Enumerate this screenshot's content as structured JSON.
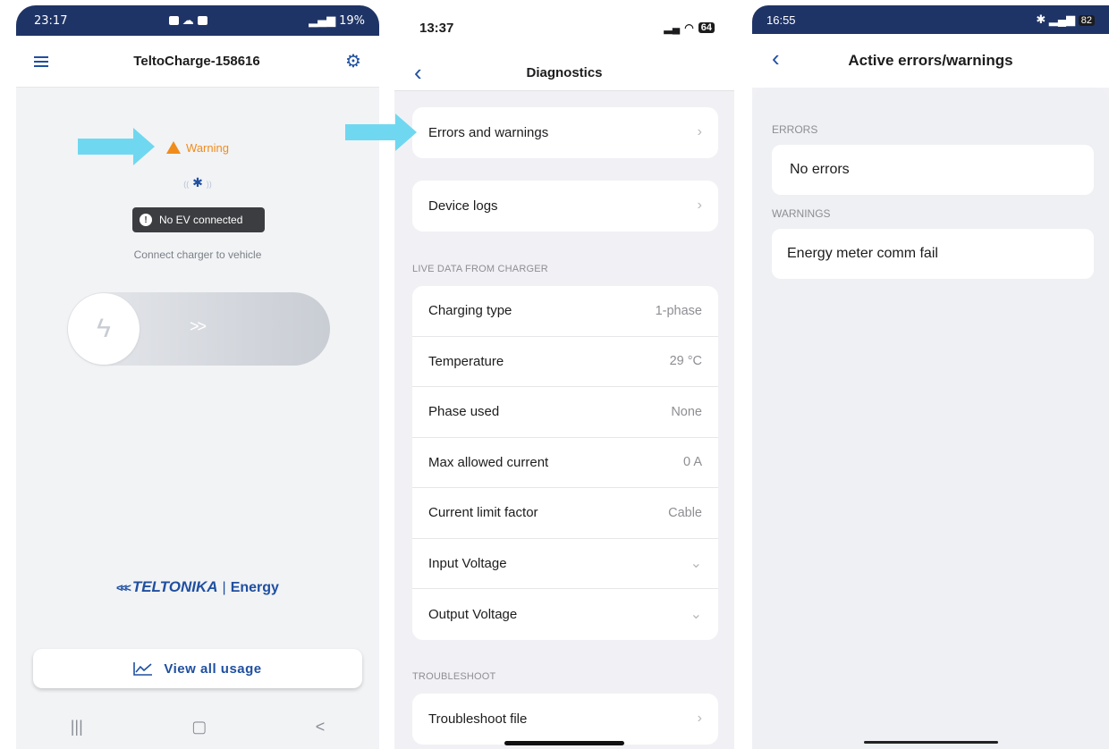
{
  "screen1": {
    "status_time": "23:17",
    "status_right": "19%",
    "title": "TeltoCharge-158616",
    "warning_label": "Warning",
    "bluetooth_icon": "bluetooth-icon",
    "ev_status": "No EV connected",
    "connect_hint": "Connect charger to vehicle",
    "slider_chevrons": ">>",
    "logo_brand": "TELTONIKA",
    "logo_separator": "|",
    "logo_energy": "Energy",
    "view_usage_label": "View all usage",
    "nav": [
      "|||",
      "▢",
      "<"
    ]
  },
  "screen2": {
    "status_time": "13:37",
    "battery": "64",
    "title": "Diagnostics",
    "errors_item": "Errors and warnings",
    "logs_item": "Device logs",
    "live_section": "LIVE DATA FROM CHARGER",
    "live_rows": [
      {
        "label": "Charging type",
        "value": "1-phase"
      },
      {
        "label": "Temperature",
        "value": "29 °C"
      },
      {
        "label": "Phase used",
        "value": "None"
      },
      {
        "label": "Max allowed current",
        "value": "0 A"
      },
      {
        "label": "Current limit factor",
        "value": "Cable"
      },
      {
        "label": "Input Voltage",
        "value": ""
      },
      {
        "label": "Output Voltage",
        "value": ""
      }
    ],
    "troubleshoot_section": "TROUBLESHOOT",
    "troubleshoot_item": "Troubleshoot file"
  },
  "screen3": {
    "status_time": "16:55",
    "status_battery": "82",
    "title": "Active errors/warnings",
    "errors_label": "ERRORS",
    "errors_value": "No errors",
    "warnings_label": "WARNINGS",
    "warnings_value": "Energy meter comm fail"
  },
  "colors": {
    "accent": "#1f4fa0",
    "warning": "#f08c1c",
    "arrow": "#6fd8f0",
    "status_bar": "#1f3466"
  }
}
